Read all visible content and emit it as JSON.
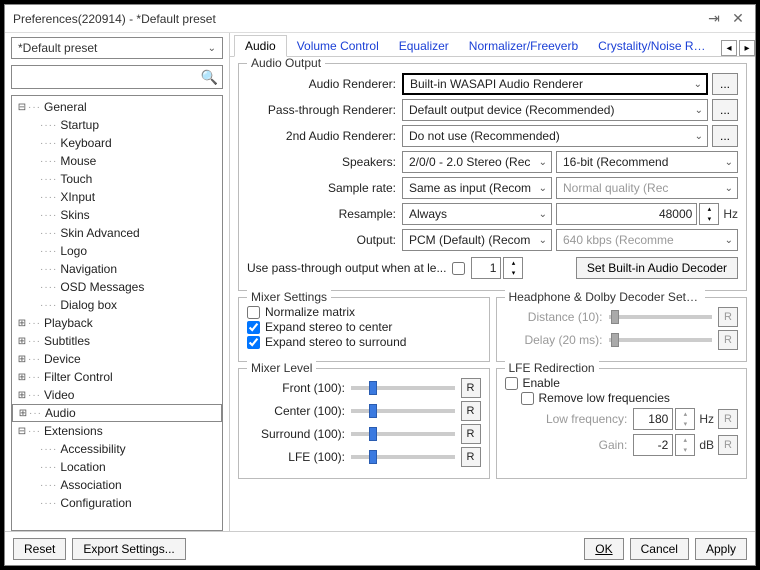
{
  "title": "Preferences(220914) - *Default preset",
  "preset": "*Default preset",
  "search_placeholder": "",
  "tree": {
    "general": "General",
    "general_children": [
      "Startup",
      "Keyboard",
      "Mouse",
      "Touch",
      "XInput",
      "Skins",
      "Skin Advanced",
      "Logo",
      "Navigation",
      "OSD Messages",
      "Dialog box"
    ],
    "others": [
      "Playback",
      "Subtitles",
      "Device",
      "Filter Control",
      "Video",
      "Audio",
      "Extensions"
    ],
    "ext_children": [
      "Accessibility",
      "Location",
      "Association",
      "Configuration"
    ]
  },
  "tabs": [
    "Audio",
    "Volume Control",
    "Equalizer",
    "Normalizer/Freeverb",
    "Crystality/Noise Redu"
  ],
  "audio_output": {
    "legend": "Audio Output",
    "labels": {
      "renderer": "Audio Renderer:",
      "passthrough": "Pass-through Renderer:",
      "second": "2nd Audio Renderer:",
      "speakers": "Speakers:",
      "samplerate": "Sample rate:",
      "resample": "Resample:",
      "output": "Output:"
    },
    "renderer": "Built-in WASAPI Audio Renderer",
    "passthrough": "Default output device (Recommended)",
    "second": "Do not use (Recommended)",
    "speakers": "2/0/0 - 2.0 Stereo (Rec",
    "bitdepth": "16-bit (Recommend",
    "samplerate": "Same as input (Recom",
    "quality": "Normal quality (Rec",
    "resample": "Always",
    "resample_hz": "48000",
    "hz_unit": "Hz",
    "output": "PCM (Default) (Recom",
    "bitrate": "640 kbps (Recomme",
    "passthrough_text": "Use pass-through output when at le...",
    "passthrough_num": "1",
    "decoder_btn": "Set Built-in Audio Decoder"
  },
  "mixer_settings": {
    "legend": "Mixer Settings",
    "normalize": "Normalize matrix",
    "expand_center": "Expand stereo to center",
    "expand_surround": "Expand stereo to surround"
  },
  "headphone": {
    "legend": "Headphone & Dolby Decoder Setti...",
    "distance_label": "Distance (10):",
    "delay_label": "Delay (20 ms):",
    "r": "R"
  },
  "mixer_level": {
    "legend": "Mixer Level",
    "front": "Front (100):",
    "center": "Center (100):",
    "surround": "Surround (100):",
    "lfe": "LFE (100):",
    "r": "R"
  },
  "lfe": {
    "legend": "LFE Redirection",
    "enable": "Enable",
    "remove": "Remove low frequencies",
    "lowfreq_label": "Low frequency:",
    "lowfreq": "180",
    "hz": "Hz",
    "gain_label": "Gain:",
    "gain": "-2",
    "db": "dB",
    "r": "R"
  },
  "footer": {
    "reset": "Reset",
    "export": "Export Settings...",
    "ok": "OK",
    "cancel": "Cancel",
    "apply": "Apply"
  },
  "dots": "..."
}
